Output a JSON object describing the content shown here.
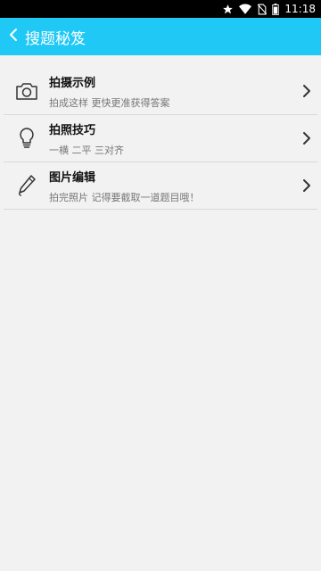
{
  "status_bar": {
    "time": "11:18",
    "icons": [
      "star-icon",
      "wifi-icon",
      "no-sim-icon",
      "battery-icon"
    ]
  },
  "app_bar": {
    "title": "搜题秘笈",
    "back_icon": "chevron-left-icon",
    "background": "#20c8f6"
  },
  "items": [
    {
      "icon": "camera-icon",
      "title": "拍摄示例",
      "subtitle": "拍成这样 更快更准获得答案"
    },
    {
      "icon": "lightbulb-icon",
      "title": "拍照技巧",
      "subtitle": "一横 二平 三对齐"
    },
    {
      "icon": "pen-icon",
      "title": "图片编辑",
      "subtitle": "拍完照片 记得要截取一道题目哦！"
    }
  ]
}
